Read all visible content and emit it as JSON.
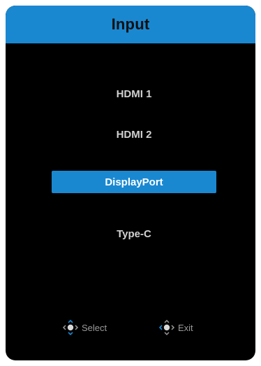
{
  "osd": {
    "title": "Input",
    "items": [
      {
        "label": "HDMI 1",
        "selected": false
      },
      {
        "label": "HDMI 2",
        "selected": false
      },
      {
        "label": "DisplayPort",
        "selected": true
      },
      {
        "label": "Type-C",
        "selected": false
      }
    ],
    "hints": {
      "select_label": "Select",
      "select_icon": "joystick-up-down-icon",
      "exit_label": "Exit",
      "exit_icon": "joystick-left-icon"
    },
    "colors": {
      "accent": "#1a88d1",
      "background": "#000000",
      "text": "#d2d2d2",
      "hint_text": "#9a9a9a"
    }
  }
}
